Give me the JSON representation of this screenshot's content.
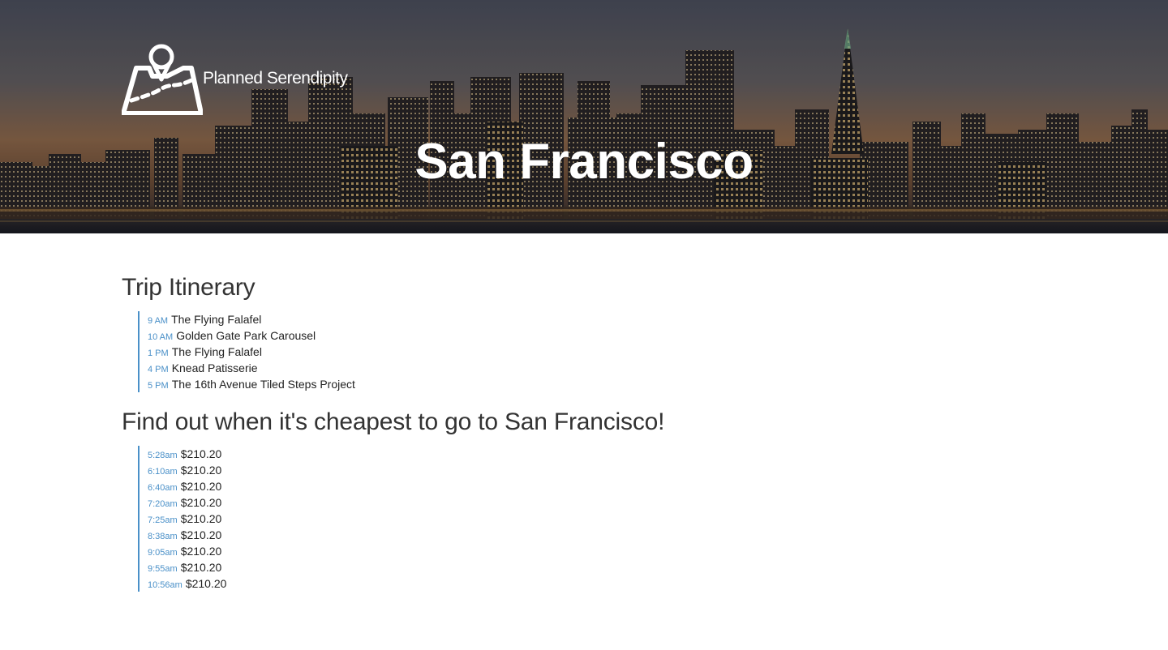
{
  "brand": {
    "name": "Planned Serendipity",
    "logo_icon": "map-pin-icon"
  },
  "hero": {
    "title": "San Francisco"
  },
  "itinerary": {
    "title": "Trip Itinerary",
    "items": [
      {
        "time": "9 AM",
        "place": "The Flying Falafel"
      },
      {
        "time": "10 AM",
        "place": "Golden Gate Park Carousel"
      },
      {
        "time": "1 PM",
        "place": "The Flying Falafel"
      },
      {
        "time": "4 PM",
        "place": "Knead Patisserie"
      },
      {
        "time": "5 PM",
        "place": "The 16th Avenue Tiled Steps Project"
      }
    ]
  },
  "prices": {
    "title": "Find out when it's cheapest to go to San Francisco!",
    "items": [
      {
        "time": "5:28am",
        "price": "$210.20"
      },
      {
        "time": "6:10am",
        "price": "$210.20"
      },
      {
        "time": "6:40am",
        "price": "$210.20"
      },
      {
        "time": "7:20am",
        "price": "$210.20"
      },
      {
        "time": "7:25am",
        "price": "$210.20"
      },
      {
        "time": "8:38am",
        "price": "$210.20"
      },
      {
        "time": "9:05am",
        "price": "$210.20"
      },
      {
        "time": "9:55am",
        "price": "$210.20"
      },
      {
        "time": "10:56am",
        "price": "$210.20"
      }
    ]
  },
  "colors": {
    "accent": "#4a90c8",
    "text": "#333333",
    "hero_text": "#ffffff"
  }
}
